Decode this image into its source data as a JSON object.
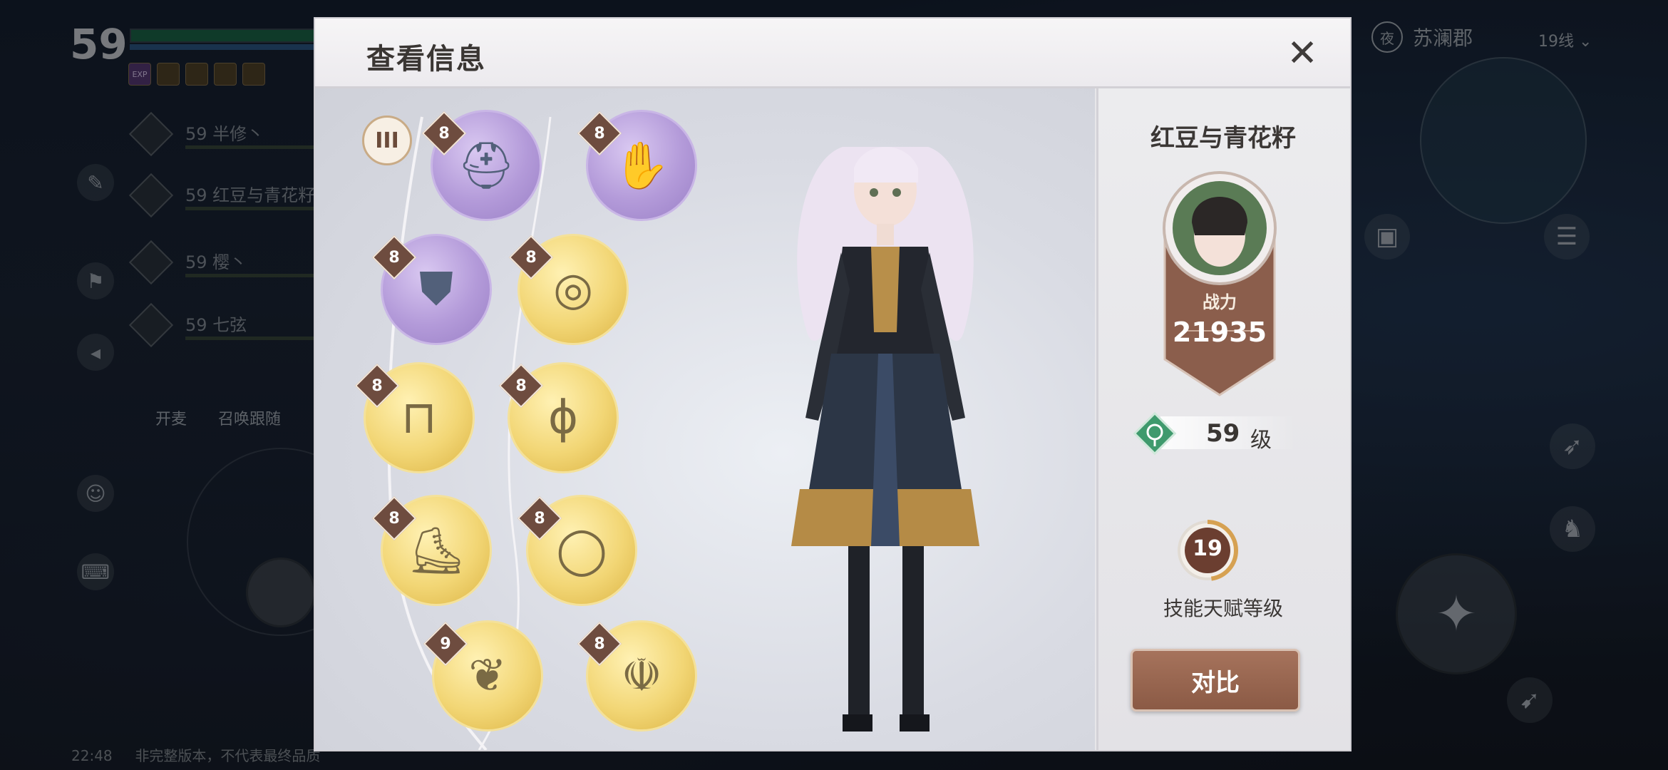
{
  "hud": {
    "player_level": "59",
    "exp_buff_label": "EXP",
    "party": [
      {
        "text": "59 半修丶"
      },
      {
        "text": "59 红豆与青花籽"
      },
      {
        "text": "59 樱丶"
      },
      {
        "text": "59 七弦"
      }
    ],
    "mic_label": "开麦",
    "summon_label": "召唤跟随",
    "time": "22:48",
    "build_notice": "非完整版本，不代表最终品质",
    "location": "苏澜郡",
    "night_badge": "夜",
    "channel": "19线"
  },
  "dialog": {
    "title": "查看信息",
    "tier": "III",
    "equipment": [
      {
        "slot": "helmet-slot",
        "rarity": "purple",
        "level": "8",
        "icon": "helmet-icon"
      },
      {
        "slot": "gloves-slot",
        "rarity": "purple",
        "level": "8",
        "icon": "gloves-icon"
      },
      {
        "slot": "armor-slot",
        "rarity": "purple",
        "level": "8",
        "icon": "armor-icon"
      },
      {
        "slot": "necklace-slot",
        "rarity": "gold",
        "level": "8",
        "icon": "necklace-icon"
      },
      {
        "slot": "pants-slot",
        "rarity": "gold",
        "level": "8",
        "icon": "pants-icon"
      },
      {
        "slot": "earring-slot",
        "rarity": "gold",
        "level": "8",
        "icon": "earring-icon"
      },
      {
        "slot": "boots-slot",
        "rarity": "gold",
        "level": "8",
        "icon": "boots-icon"
      },
      {
        "slot": "ring-slot",
        "rarity": "gold",
        "level": "8",
        "icon": "ring-icon"
      },
      {
        "slot": "pendant-slot",
        "rarity": "gold",
        "level": "9",
        "icon": "qilin-pendant-icon"
      },
      {
        "slot": "dragon-charm-slot",
        "rarity": "gold",
        "level": "8",
        "icon": "dragon-charm-icon"
      }
    ],
    "player_name": "红豆与青花籽",
    "power_label": "战力",
    "power_value": "21935",
    "level_value": "59",
    "level_unit": "级",
    "talent_value": "19",
    "talent_label": "技能天赋等级",
    "compare_label": "对比"
  },
  "colors": {
    "dialog_bg": "#e7e6e9",
    "brown_accent": "#8b5a45",
    "purple_rarity": "#b39ad9",
    "gold_rarity": "#f2d675",
    "badge_brown": "#6e4c3f"
  }
}
